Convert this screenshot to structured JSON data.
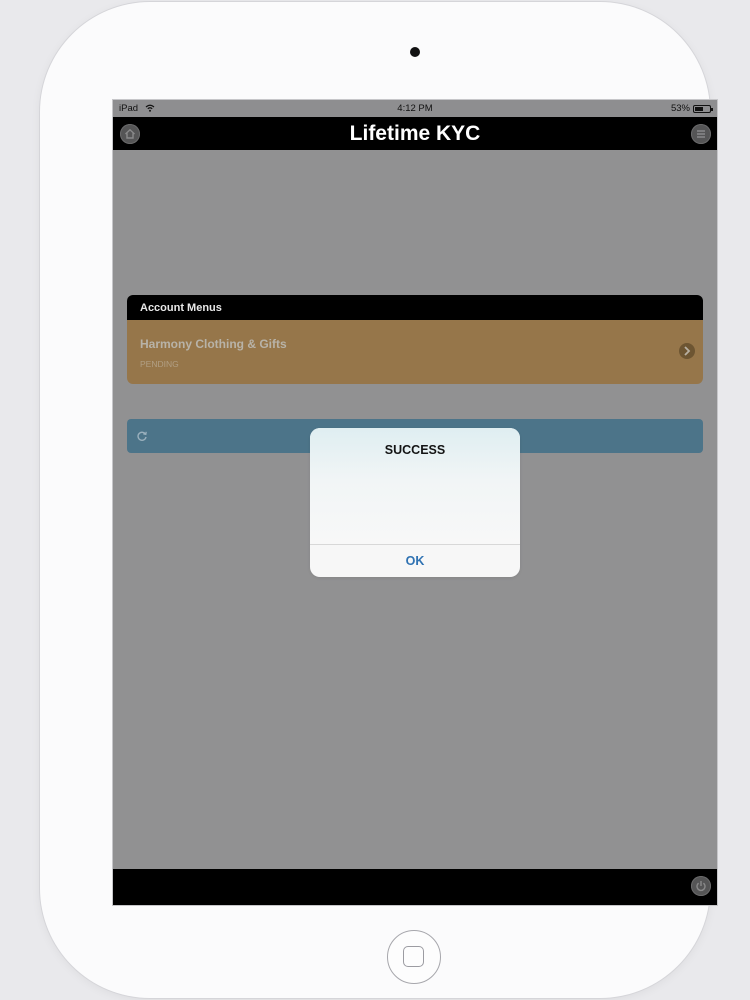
{
  "status_bar": {
    "device": "iPad",
    "time": "4:12 PM",
    "battery": "53%"
  },
  "header": {
    "title": "Lifetime KYC"
  },
  "account_menus": {
    "heading": "Account Menus",
    "items": [
      {
        "name": "Harmony Clothing & Gifts",
        "status": "PENDING"
      }
    ]
  },
  "alert": {
    "title": "SUCCESS",
    "ok_label": "OK"
  },
  "colors": {
    "overlay": "#919192",
    "account_item": "#96764a",
    "refresh_bar": "#4c7489",
    "ok_text": "#2f72b2"
  },
  "icons": {
    "header_left": "home-icon",
    "header_right": "menu-icon",
    "item_action": "chevron-right-icon",
    "refresh": "refresh-icon",
    "footer_right": "power-icon"
  }
}
